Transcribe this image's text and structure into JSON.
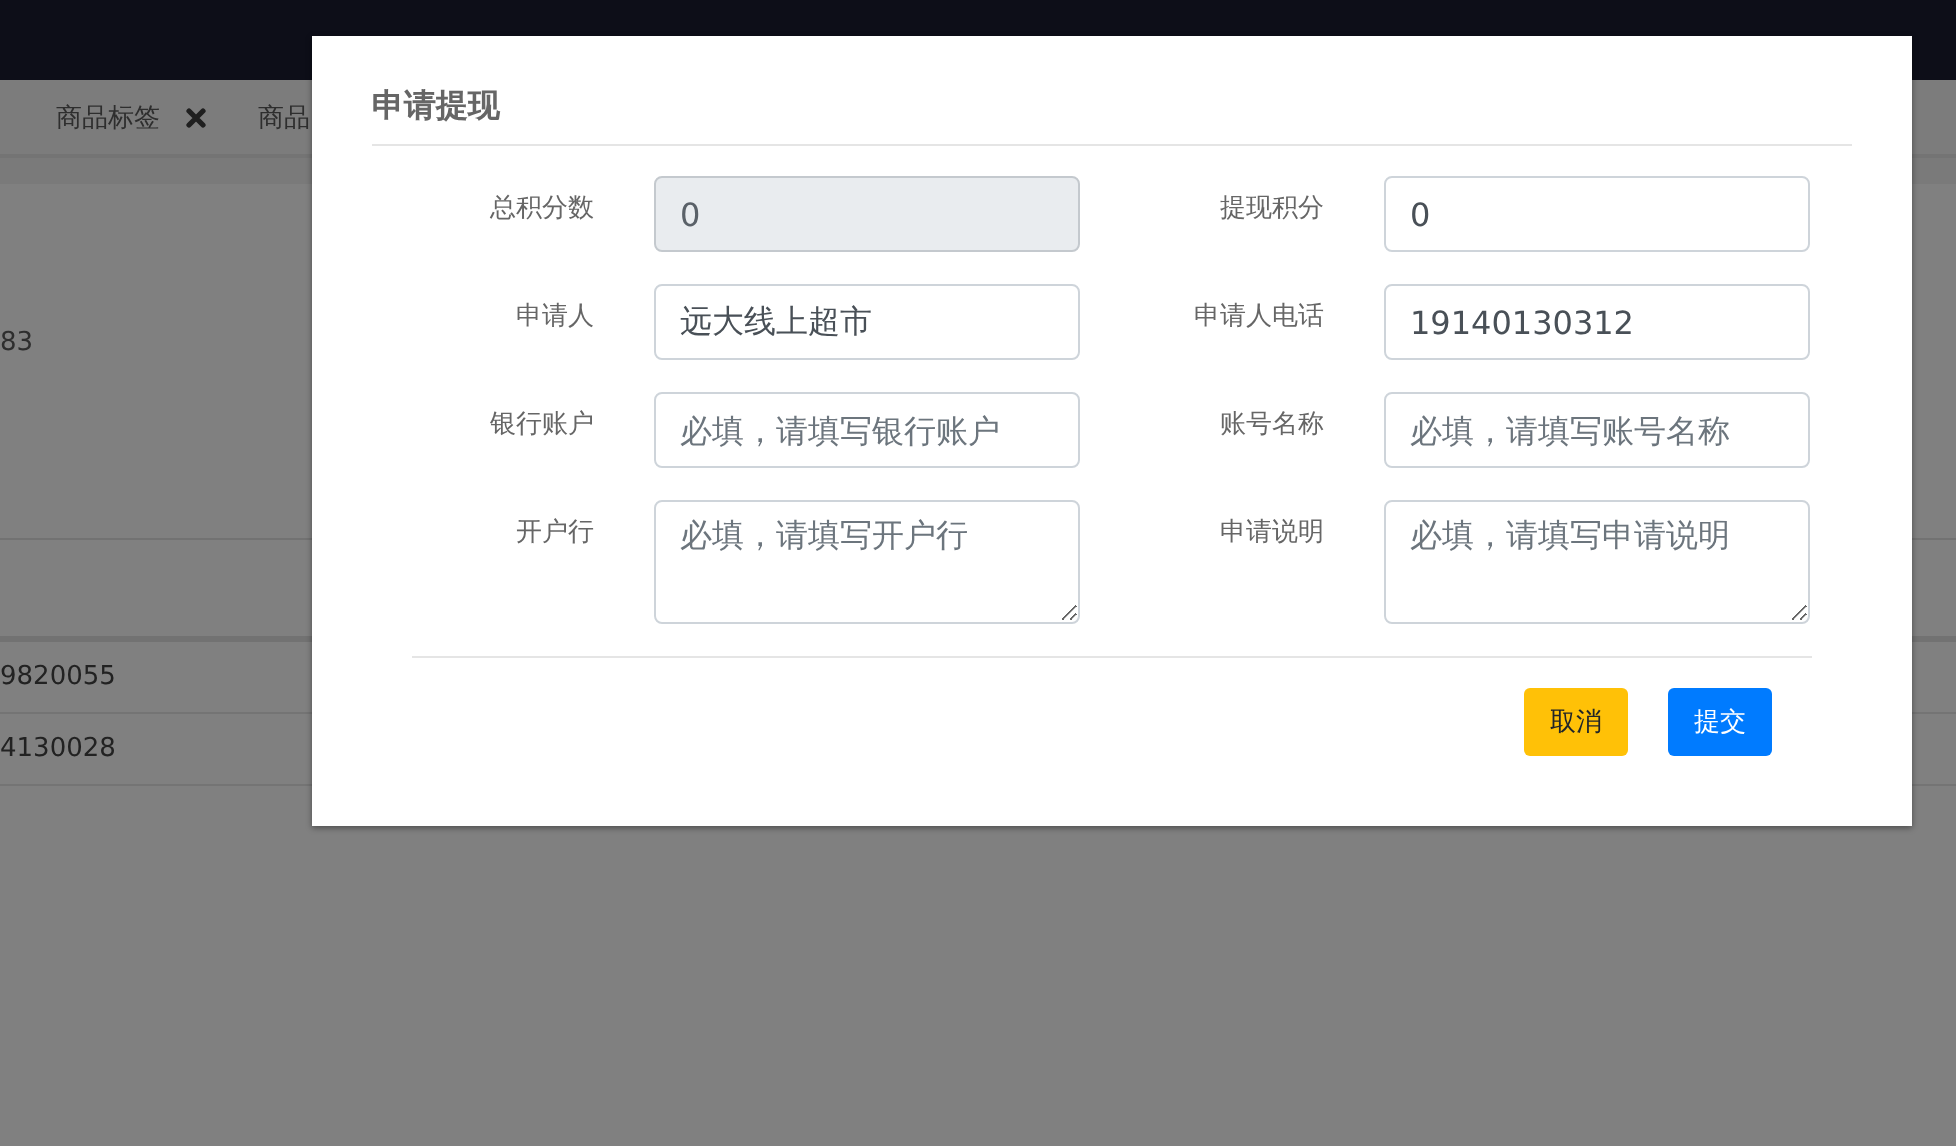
{
  "background": {
    "tabs": [
      {
        "label": "商品标签",
        "closable": true
      },
      {
        "label": "商品",
        "closable": false
      }
    ],
    "texts": [
      "83",
      "9820055",
      "4130028"
    ]
  },
  "dialog": {
    "title": "申请提现",
    "fields": [
      {
        "label": "总积分数",
        "kind": "input",
        "value": "0",
        "disabled": true
      },
      {
        "label": "提现积分",
        "kind": "input",
        "value": "0",
        "disabled": false
      },
      {
        "label": "申请人",
        "kind": "input",
        "value": "远大线上超市",
        "disabled": false
      },
      {
        "label": "申请人电话",
        "kind": "input",
        "value": "19140130312",
        "disabled": false
      },
      {
        "label": "银行账户",
        "kind": "input",
        "placeholder": "必填，请填写银行账户",
        "disabled": false
      },
      {
        "label": "账号名称",
        "kind": "input",
        "placeholder": "必填，请填写账号名称",
        "disabled": false
      },
      {
        "label": "开户行",
        "kind": "textarea",
        "placeholder": "必填，请填写开户行",
        "disabled": false
      },
      {
        "label": "申请说明",
        "kind": "textarea",
        "placeholder": "必填，请填写申请说明",
        "disabled": false
      }
    ],
    "buttons": [
      {
        "label": "取消",
        "kind": "warning"
      },
      {
        "label": "提交",
        "kind": "primary"
      }
    ]
  }
}
